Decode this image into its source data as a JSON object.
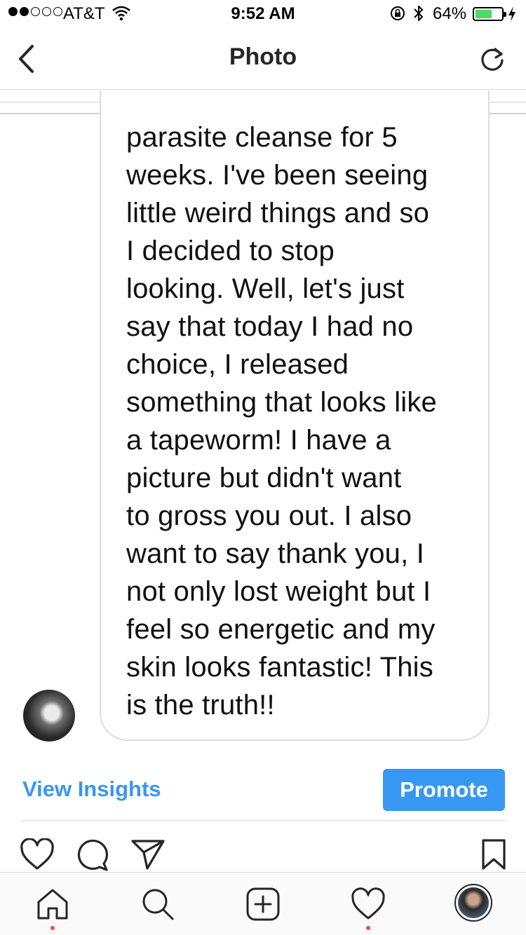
{
  "status_bar": {
    "carrier": "AT&T",
    "time": "9:52 AM",
    "battery_percent": "64%",
    "battery_level": 0.64,
    "signal_dots_filled": 2,
    "signal_dots_total": 5
  },
  "navbar": {
    "title": "Photo",
    "back_icon": "chevron-left-icon",
    "refresh_icon": "refresh-icon"
  },
  "post": {
    "message_lines": [
      "parasite cleanse for 5",
      "weeks. I've been seeing",
      "little weird things and so",
      "I decided to stop",
      "looking. Well, let's just",
      "say that today I had no",
      "choice, I released",
      "something that looks like",
      "a tapeworm! I have a",
      "picture but didn't want",
      "to gross you out. I also",
      "want to say thank you, I",
      "not only lost weight but I",
      "feel so energetic and my",
      "skin looks fantastic! This",
      "is the truth!!"
    ]
  },
  "actions": {
    "view_insights": "View Insights",
    "promote": "Promote"
  },
  "colors": {
    "accent": "#3897f0",
    "battery": "#4cd964",
    "notification_dot": "#ed4956"
  }
}
